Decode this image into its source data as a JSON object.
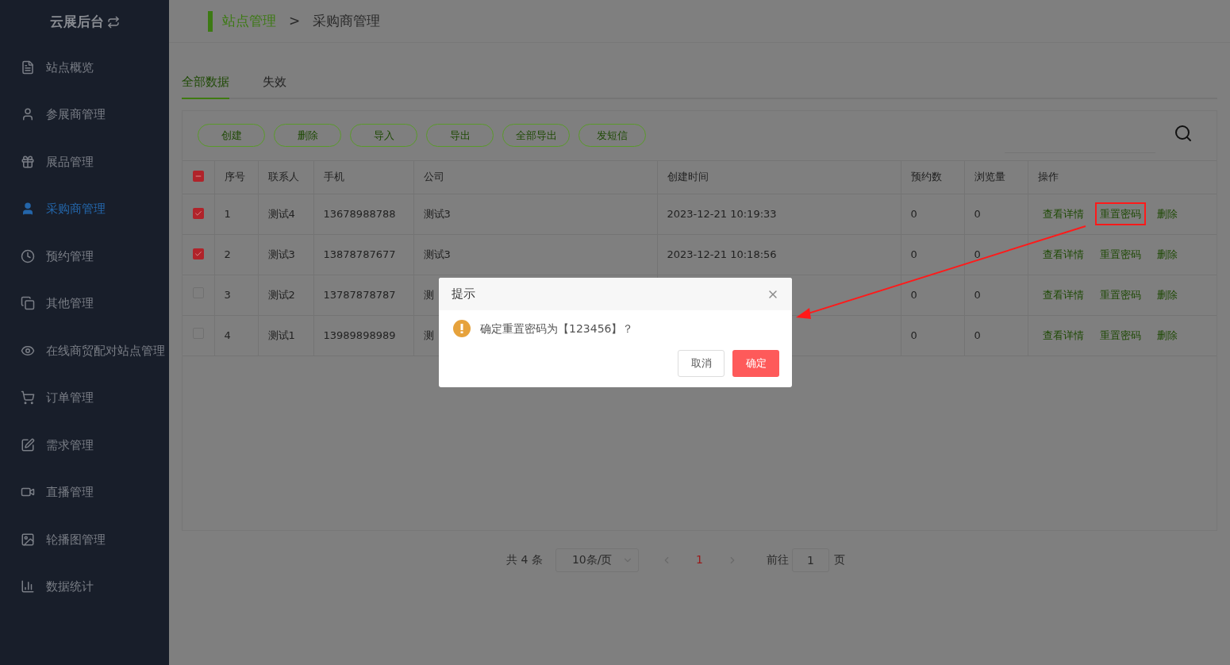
{
  "sidebar": {
    "title": "云展后台",
    "items": [
      {
        "label": "站点概览",
        "selected": false
      },
      {
        "label": "参展商管理",
        "selected": false
      },
      {
        "label": "展品管理",
        "selected": false
      },
      {
        "label": "采购商管理",
        "selected": true
      },
      {
        "label": "预约管理",
        "selected": false
      },
      {
        "label": "其他管理",
        "selected": false
      },
      {
        "label": "在线商贸配对站点管理",
        "selected": false
      },
      {
        "label": "订单管理",
        "selected": false
      },
      {
        "label": "需求管理",
        "selected": false
      },
      {
        "label": "直播管理",
        "selected": false
      },
      {
        "label": "轮播图管理",
        "selected": false
      },
      {
        "label": "数据统计",
        "selected": false
      }
    ]
  },
  "breadcrumb": {
    "parent": "站点管理",
    "separator": ">",
    "current": "采购商管理"
  },
  "tabs": [
    {
      "label": "全部数据",
      "selected": true
    },
    {
      "label": "失效",
      "selected": false
    }
  ],
  "toolbar": {
    "buttons": [
      "创建",
      "删除",
      "导入",
      "导出",
      "全部导出",
      "发短信"
    ]
  },
  "table": {
    "select_all": {
      "indeterminate": true
    },
    "columns": [
      "序号",
      "联系人",
      "手机",
      "公司",
      "创建时间",
      "预约数",
      "浏览量",
      "操作"
    ],
    "rows": [
      {
        "checked": true,
        "cells": [
          "1",
          "测试4",
          "13678988788",
          "测试3",
          "2023-12-21 10:19:33",
          "0",
          "0"
        ],
        "actions": [
          {
            "label": "查看详情",
            "highlighted": false
          },
          {
            "label": "重置密码",
            "highlighted": true
          },
          {
            "label": "删除",
            "highlighted": false
          }
        ]
      },
      {
        "checked": true,
        "cells": [
          "2",
          "测试3",
          "13878787677",
          "测试3",
          "2023-12-21 10:18:56",
          "0",
          "0"
        ],
        "actions": [
          {
            "label": "查看详情",
            "highlighted": false
          },
          {
            "label": "重置密码",
            "highlighted": false
          },
          {
            "label": "删除",
            "highlighted": false
          }
        ]
      },
      {
        "checked": false,
        "cells": [
          "3",
          "测试2",
          "13787878787",
          "测",
          null,
          "0",
          "0"
        ],
        "actions": [
          {
            "label": "查看详情",
            "highlighted": false
          },
          {
            "label": "重置密码",
            "highlighted": false
          },
          {
            "label": "删除",
            "highlighted": false
          }
        ]
      },
      {
        "checked": false,
        "cells": [
          "4",
          "测试1",
          "13989898989",
          "测",
          null,
          "0",
          "0"
        ],
        "actions": [
          {
            "label": "查看详情",
            "highlighted": false
          },
          {
            "label": "重置密码",
            "highlighted": false
          },
          {
            "label": "删除",
            "highlighted": false
          }
        ]
      }
    ]
  },
  "pagination": {
    "total": "共 4 条",
    "page_size": "10条/页",
    "pages": [
      {
        "label": "1",
        "selected": true
      }
    ],
    "goto_label": "前往",
    "goto_value": "1",
    "goto_suffix": "页"
  },
  "dialog": {
    "title": "提示",
    "message": "确定重置密码为【123456】？",
    "cancel": "取消",
    "confirm": "确定"
  }
}
